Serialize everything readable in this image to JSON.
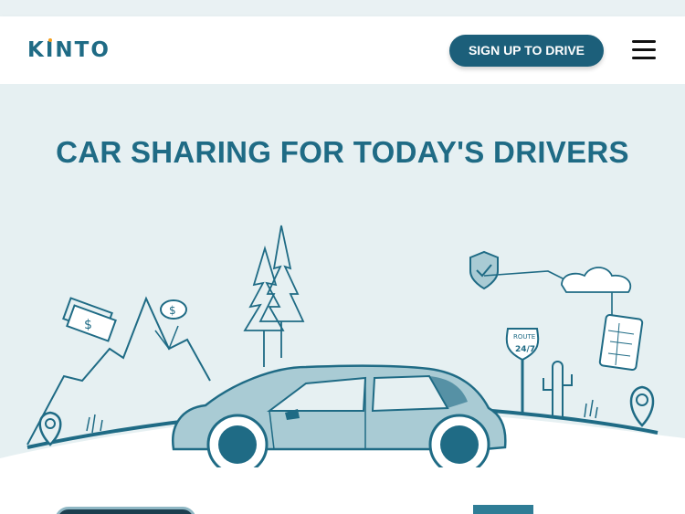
{
  "header": {
    "logo_text": "KINTO",
    "signup_label": "SIGN UP TO DRIVE",
    "menu_icon": "hamburger-menu-icon"
  },
  "hero": {
    "title": "CAR SHARING FOR TODAY'S DRIVERS",
    "illustration_labels": {
      "route_sign": "ROUTE",
      "route_number": "24/7",
      "currency": "$"
    }
  },
  "colors": {
    "brand": "#1f6b85",
    "button": "#1c5f7a",
    "hero_bg": "#e6f0f2",
    "car_fill": "#a9cbd4",
    "accent_orange": "#f59f1d"
  }
}
